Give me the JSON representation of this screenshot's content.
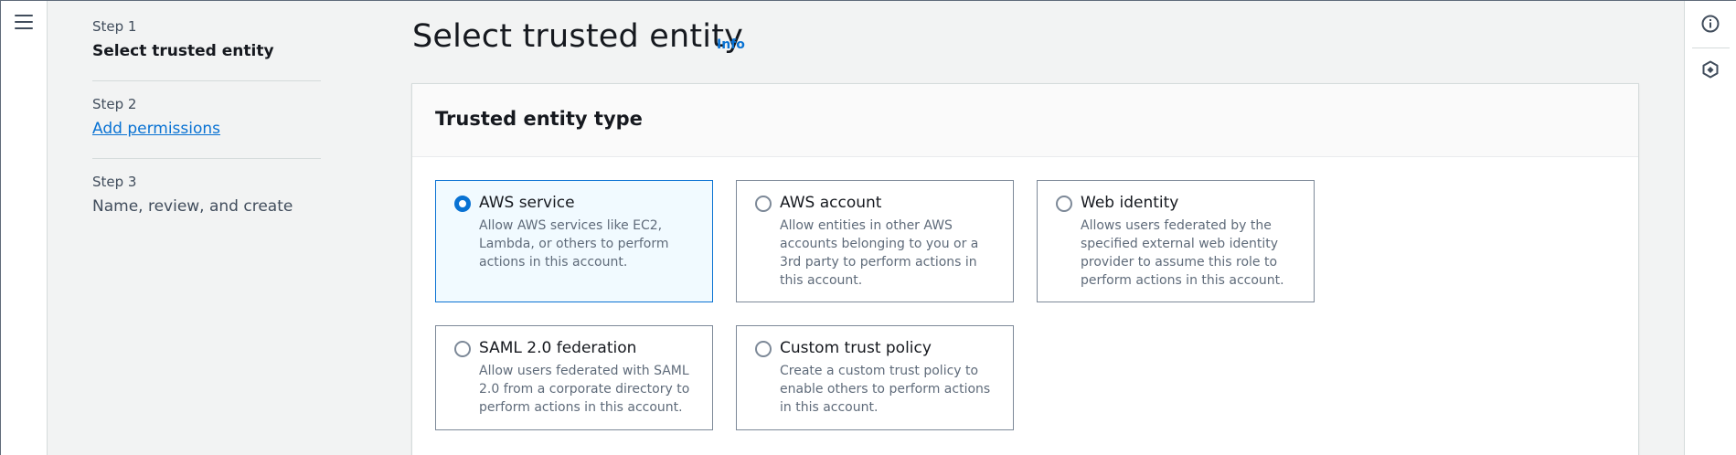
{
  "steps": [
    {
      "number": "Step 1",
      "title": "Select trusted entity",
      "state": "current"
    },
    {
      "number": "Step 2",
      "title": "Add permissions",
      "state": "link"
    },
    {
      "number": "Step 3",
      "title": "Name, review, and create",
      "state": "disabled"
    }
  ],
  "page": {
    "title": "Select trusted entity",
    "info_link": "Info"
  },
  "trusted_entity": {
    "title": "Trusted entity type",
    "options": [
      {
        "label": "AWS service",
        "description": "Allow AWS services like EC2, Lambda, or others to perform actions in this account.",
        "selected": true
      },
      {
        "label": "AWS account",
        "description": "Allow entities in other AWS accounts belonging to you or a 3rd party to perform actions in this account.",
        "selected": false
      },
      {
        "label": "Web identity",
        "description": "Allows users federated by the specified external web identity provider to assume this role to perform actions in this account.",
        "selected": false
      },
      {
        "label": "SAML 2.0 federation",
        "description": "Allow users federated with SAML 2.0 from a corporate directory to perform actions in this account.",
        "selected": false
      },
      {
        "label": "Custom trust policy",
        "description": "Create a custom trust policy to enable others to perform actions in this account.",
        "selected": false
      }
    ]
  },
  "icons": {
    "menu": "hamburger-menu-icon",
    "info_panel": "info-circle-icon",
    "feedback": "hexagon-badge-icon"
  },
  "colors": {
    "accent": "#0972d3",
    "selected_bg": "#f1faff",
    "page_bg": "#f2f3f3"
  }
}
